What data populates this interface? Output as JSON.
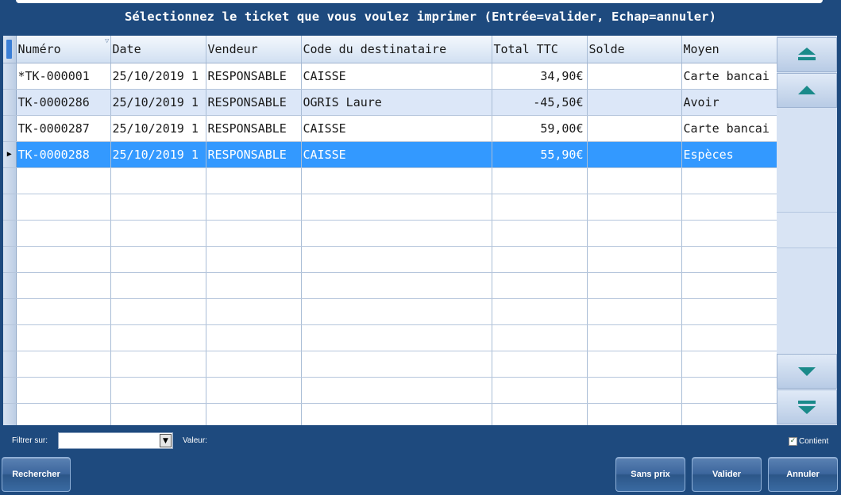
{
  "title": "Sélectionnez le ticket que vous voulez imprimer (Entrée=valider, Echap=annuler)",
  "colors": {
    "background": "#1e4a7e",
    "selected_row": "#3399ff",
    "alt_row": "#dce7f8",
    "scroll_arrow": "#1a8a8a"
  },
  "table": {
    "columns": [
      "Numéro",
      "Date",
      "Vendeur",
      "Code du destinataire",
      "Total TTC",
      "Solde",
      "Moyen"
    ],
    "rows": [
      {
        "numero": "*TK-000001",
        "date": "25/10/2019 1",
        "vendeur": "RESPONSABLE",
        "code": "CAISSE",
        "total": "34,90€",
        "solde": "",
        "moyen": "Carte bancai"
      },
      {
        "numero": "TK-0000286",
        "date": "25/10/2019 1",
        "vendeur": "RESPONSABLE",
        "code": "OGRIS Laure",
        "total": "-45,50€",
        "solde": "",
        "moyen": "Avoir"
      },
      {
        "numero": "TK-0000287",
        "date": "25/10/2019 1",
        "vendeur": "RESPONSABLE",
        "code": "CAISSE",
        "total": "59,00€",
        "solde": "",
        "moyen": "Carte bancai"
      },
      {
        "numero": "TK-0000288",
        "date": "25/10/2019 1",
        "vendeur": "RESPONSABLE",
        "code": "CAISSE",
        "total": "55,90€",
        "solde": "",
        "moyen": "Espèces"
      }
    ],
    "selected_row_index": 3
  },
  "scrollbar": {
    "icons": [
      "page-up-icon",
      "line-up-icon",
      "line-down-icon",
      "page-down-icon"
    ]
  },
  "filter": {
    "label": "Filtrer sur:",
    "value": "",
    "value_label": "Valeur:"
  },
  "contient": {
    "label": "Contient",
    "checked": true
  },
  "buttons": {
    "rechercher": "Rechercher",
    "sans_prix": "Sans prix",
    "valider": "Valider",
    "annuler": "Annuler"
  }
}
